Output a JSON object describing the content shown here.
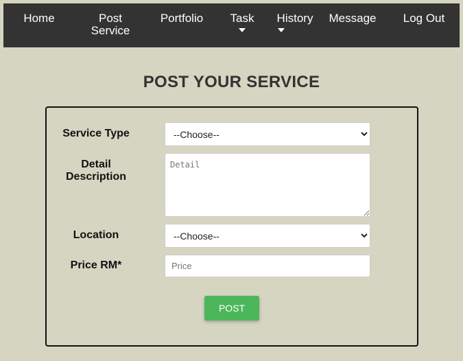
{
  "nav": {
    "home": "Home",
    "post_line1": "Post",
    "post_line2": "Service",
    "portfolio": "Portfolio",
    "task": "Task",
    "history": "History",
    "message": "Message",
    "logout": "Log Out"
  },
  "page": {
    "title": "POST YOUR SERVICE"
  },
  "form": {
    "service_type_label": "Service Type",
    "service_type_value": "--Choose--",
    "detail_label_line1": "Detail",
    "detail_label_line2": "Description",
    "detail_placeholder": "Detail",
    "location_label": "Location",
    "location_value": "--Choose--",
    "price_label": "Price RM*",
    "price_placeholder": "Price",
    "post_label": "POST"
  },
  "colors": {
    "background": "#d6d5c1",
    "navbar": "#333333",
    "post_button": "#4cb75a"
  }
}
